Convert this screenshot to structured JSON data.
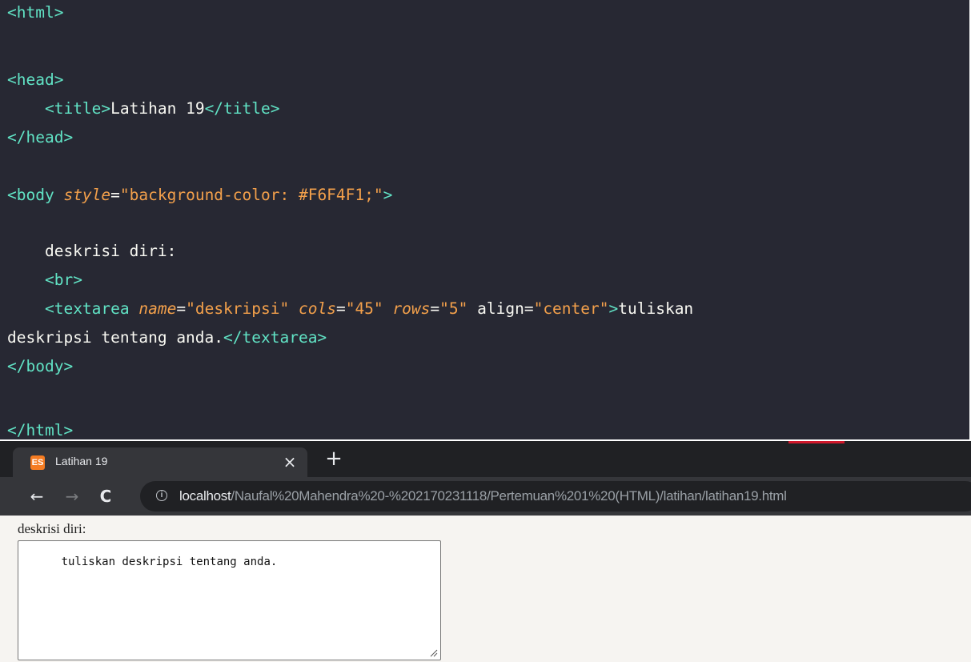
{
  "editor": {
    "lines": [
      {
        "tokens": [
          {
            "t": "tag",
            "v": "<html>"
          }
        ]
      },
      {
        "tokens": []
      },
      {
        "tokens": [
          {
            "t": "tag",
            "v": "<head>"
          }
        ]
      },
      {
        "tokens": [
          {
            "t": "text",
            "v": "    "
          },
          {
            "t": "tag",
            "v": "<title>"
          },
          {
            "t": "text",
            "v": "Latihan 19"
          },
          {
            "t": "tag",
            "v": "</title>"
          }
        ]
      },
      {
        "tokens": [
          {
            "t": "tag",
            "v": "</head>"
          }
        ]
      },
      {
        "tokens": []
      },
      {
        "tokens": [
          {
            "t": "tag",
            "v": "<body "
          },
          {
            "t": "attr",
            "v": "style"
          },
          {
            "t": "eq",
            "v": "="
          },
          {
            "t": "str",
            "v": "\"background-color: #F6F4F1;\""
          },
          {
            "t": "tag",
            "v": ">"
          }
        ]
      },
      {
        "tokens": []
      },
      {
        "tokens": [
          {
            "t": "text",
            "v": "    deskrisi diri:"
          }
        ]
      },
      {
        "tokens": [
          {
            "t": "text",
            "v": "    "
          },
          {
            "t": "tag",
            "v": "<br>"
          }
        ]
      },
      {
        "tokens": [
          {
            "t": "text",
            "v": "    "
          },
          {
            "t": "tag",
            "v": "<textarea "
          },
          {
            "t": "attr",
            "v": "name"
          },
          {
            "t": "eq",
            "v": "="
          },
          {
            "t": "str",
            "v": "\"deskripsi\""
          },
          {
            "t": "text",
            "v": " "
          },
          {
            "t": "attr",
            "v": "cols"
          },
          {
            "t": "eq",
            "v": "="
          },
          {
            "t": "str",
            "v": "\"45\""
          },
          {
            "t": "text",
            "v": " "
          },
          {
            "t": "attr",
            "v": "rows"
          },
          {
            "t": "eq",
            "v": "="
          },
          {
            "t": "str",
            "v": "\"5\""
          },
          {
            "t": "text",
            "v": " "
          },
          {
            "t": "plainattr",
            "v": "align"
          },
          {
            "t": "eq",
            "v": "="
          },
          {
            "t": "str",
            "v": "\"center\""
          },
          {
            "t": "tag",
            "v": ">"
          },
          {
            "t": "text",
            "v": "tuliskan"
          }
        ]
      },
      {
        "tokens": [
          {
            "t": "text",
            "v": "deskripsi tentang anda."
          },
          {
            "t": "tag",
            "v": "</textarea>"
          }
        ]
      },
      {
        "tokens": [
          {
            "t": "tag",
            "v": "</body>"
          }
        ]
      },
      {
        "tokens": []
      },
      {
        "tokens": [
          {
            "t": "tag",
            "v": "</html>"
          }
        ]
      }
    ]
  },
  "browser": {
    "tab": {
      "favicon": "xampp-icon",
      "favicon_text": "ES",
      "title": "Latihan 19",
      "close_label": "×"
    },
    "new_tab_label": "+",
    "nav": {
      "back_label": "←",
      "forward_label": "→",
      "reload_label": "C"
    },
    "omnibox": {
      "info_label": "i",
      "host": "localhost",
      "path": "/Naufal%20Mahendra%20-%202170231118/Pertemuan%201%20(HTML)/latihan/latihan19.html"
    },
    "page": {
      "label": "deskrisi diri:",
      "textarea_value": "tuliskan deskripsi tentang anda."
    }
  },
  "colors": {
    "editor_bg": "#272833",
    "tag": "#61e3c5",
    "attr": "#f3a04b",
    "page_bg": "#F6F4F1"
  }
}
